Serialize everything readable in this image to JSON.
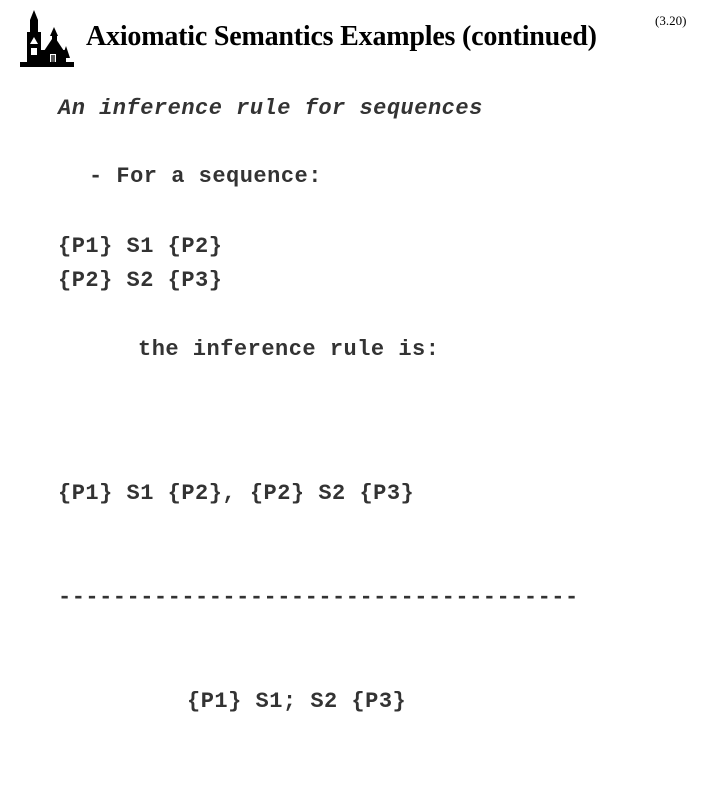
{
  "header": {
    "logo_icon": "church-silhouette-logo",
    "title": "Axiomatic Semantics Examples (continued)",
    "slide_number": "(3.20)"
  },
  "body": {
    "heading": "An inference rule for sequences",
    "bullet": "- For a sequence:",
    "premises": "{P1} S1 {P2}\n{P2} S2 {P3}",
    "connector": "the inference rule is:",
    "rule": {
      "numerator": "{P1} S1 {P2}, {P2} S2 {P3}",
      "divider": "--------------------------------------",
      "denominator": "{P1} S1; S2 {P3}"
    }
  },
  "colors": {
    "background": "#ffffff",
    "title_text": "#000000",
    "body_text": "#333333"
  }
}
